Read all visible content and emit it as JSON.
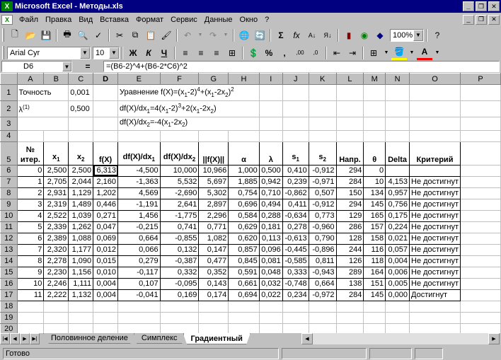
{
  "window": {
    "title": "Microsoft Excel - Методы.xls"
  },
  "menu": [
    "Файл",
    "Правка",
    "Вид",
    "Вставка",
    "Формат",
    "Сервис",
    "Данные",
    "Окно",
    "?"
  ],
  "toolbar": {
    "zoom": "100%",
    "font": "Arial Cyr",
    "size": "10"
  },
  "formula": {
    "cell": "D6",
    "eq": "=",
    "content": "=(B6-2)^4+(B6-2*C6)^2"
  },
  "columns": [
    "A",
    "B",
    "C",
    "D",
    "E",
    "F",
    "G",
    "H",
    "I",
    "J",
    "K",
    "L",
    "M",
    "N",
    "O",
    "P"
  ],
  "rows_top": {
    "r1": {
      "a": "Точность",
      "c": "0,001",
      "e": "Уравнение f(X)=(x",
      "e_sub1": "1",
      "e_mid": "-2)",
      "e_sup1": "4",
      "e_mid2": "+(x",
      "e_sub2": "1",
      "e_mid3": "-2x",
      "e_sub3": "2",
      "e_mid4": ")",
      "e_sup2": "2"
    },
    "r2": {
      "a": "λ",
      "a_sup": "(1)",
      "c": "0,500",
      "e": "df(X)/dx",
      "e_sub1": "1",
      "e_mid": "=4(x",
      "e_sub2": "1",
      "e_mid2": "-2)",
      "e_sup": "3",
      "e_mid3": "+2(x",
      "e_sub3": "1",
      "e_mid4": "-2x",
      "e_sub4": "2",
      "e_end": ")"
    },
    "r3": {
      "e": "df(X)/dx",
      "e_sub1": "2",
      "e_mid": "=-4(x",
      "e_sub2": "1",
      "e_mid2": "-2x",
      "e_sub3": "2",
      "e_end": ")"
    }
  },
  "headers": {
    "a_line1": "№",
    "a_line2": "итер.",
    "b": "x",
    "b_sub": "1",
    "c": "x",
    "c_sub": "2",
    "d": "f(X)",
    "e": "df(X)/dx",
    "e_sub": "1",
    "f": "df(X)/dx",
    "f_sub": "2",
    "g": "||f(X)||",
    "h": "α",
    "i": "λ",
    "j": "s",
    "j_sub": "1",
    "k": "s",
    "k_sub": "2",
    "l": "Напр.",
    "m": "θ",
    "n": "Delta",
    "o": "Критерий"
  },
  "data": [
    [
      "0",
      "2,500",
      "2,500",
      "6,313",
      "-4,500",
      "10,000",
      "10,966",
      "1,000",
      "0,500",
      "0,410",
      "-0,912",
      "294",
      "0",
      "",
      ""
    ],
    [
      "1",
      "2,705",
      "2,044",
      "2,160",
      "-1,363",
      "5,532",
      "5,697",
      "1,885",
      "0,942",
      "0,239",
      "-0,971",
      "284",
      "10",
      "4,153",
      "Не достигнут"
    ],
    [
      "2",
      "2,931",
      "1,129",
      "1,202",
      "4,569",
      "-2,690",
      "5,302",
      "0,754",
      "0,710",
      "-0,862",
      "0,507",
      "150",
      "134",
      "0,957",
      "Не достигнут"
    ],
    [
      "3",
      "2,319",
      "1,489",
      "0,446",
      "-1,191",
      "2,641",
      "2,897",
      "0,696",
      "0,494",
      "0,411",
      "-0,912",
      "294",
      "145",
      "0,756",
      "Не достигнут"
    ],
    [
      "4",
      "2,522",
      "1,039",
      "0,271",
      "1,456",
      "-1,775",
      "2,296",
      "0,584",
      "0,288",
      "-0,634",
      "0,773",
      "129",
      "165",
      "0,175",
      "Не достигнут"
    ],
    [
      "5",
      "2,339",
      "1,262",
      "0,047",
      "-0,215",
      "0,741",
      "0,771",
      "0,629",
      "0,181",
      "0,278",
      "-0,960",
      "286",
      "157",
      "0,224",
      "Не достигнут"
    ],
    [
      "6",
      "2,389",
      "1,088",
      "0,069",
      "0,664",
      "-0,855",
      "1,082",
      "0,620",
      "0,113",
      "-0,613",
      "0,790",
      "128",
      "158",
      "0,021",
      "Не достигнут"
    ],
    [
      "7",
      "2,320",
      "1,177",
      "0,012",
      "0,066",
      "0,132",
      "0,147",
      "0,857",
      "0,096",
      "-0,445",
      "-0,896",
      "244",
      "116",
      "0,057",
      "Не достигнут"
    ],
    [
      "8",
      "2,278",
      "1,090",
      "0,015",
      "0,279",
      "-0,387",
      "0,477",
      "0,845",
      "0,081",
      "-0,585",
      "0,811",
      "126",
      "118",
      "0,004",
      "Не достигнут"
    ],
    [
      "9",
      "2,230",
      "1,156",
      "0,010",
      "-0,117",
      "0,332",
      "0,352",
      "0,591",
      "0,048",
      "0,333",
      "-0,943",
      "289",
      "164",
      "0,006",
      "Не достигнут"
    ],
    [
      "10",
      "2,246",
      "1,111",
      "0,004",
      "0,107",
      "-0,095",
      "0,143",
      "0,661",
      "0,032",
      "-0,748",
      "0,664",
      "138",
      "151",
      "0,005",
      "Не достигнут"
    ],
    [
      "11",
      "2,222",
      "1,132",
      "0,004",
      "-0,041",
      "0,169",
      "0,174",
      "0,694",
      "0,022",
      "0,234",
      "-0,972",
      "284",
      "145",
      "0,000",
      "Достигнут"
    ]
  ],
  "tabs": [
    "Половинное деление",
    "Симплекс",
    "Градиентный"
  ],
  "status": "Готово"
}
